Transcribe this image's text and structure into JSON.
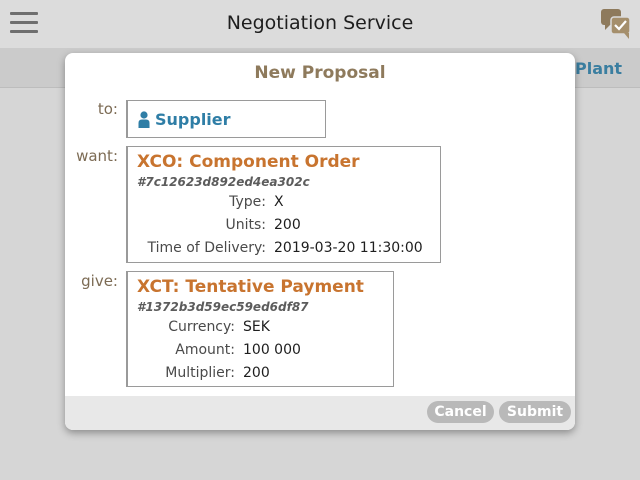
{
  "header": {
    "title": "Negotiation Service",
    "menu_icon": "hamburger-menu-icon",
    "chat_icon": "chat-approval-icon"
  },
  "background": {
    "tab_label": "Plant"
  },
  "modal": {
    "title": "New Proposal",
    "to": {
      "label": "to:",
      "party": "Supplier",
      "icon": "person-icon"
    },
    "want": {
      "label": "want:",
      "title": "XCO: Component Order",
      "hash": "#7c12623d892ed4ea302c",
      "fields": [
        {
          "label": "Type:",
          "value": "X"
        },
        {
          "label": "Units:",
          "value": "200"
        },
        {
          "label": "Time of Delivery:",
          "value": "2019-03-20 11:30:00"
        }
      ]
    },
    "give": {
      "label": "give:",
      "title": "XCT: Tentative Payment",
      "hash": "#1372b3d59ec59ed6df87",
      "fields": [
        {
          "label": "Currency:",
          "value": "SEK"
        },
        {
          "label": "Amount:",
          "value": "100 000"
        },
        {
          "label": "Multiplier:",
          "value": "200"
        }
      ]
    },
    "buttons": {
      "cancel": "Cancel",
      "submit": "Submit"
    }
  },
  "colors": {
    "accent_title": "#c8742f",
    "party_blue": "#2f7ea6",
    "modal_title": "#8e7a5c",
    "button_disabled": "#b9b9b9"
  }
}
